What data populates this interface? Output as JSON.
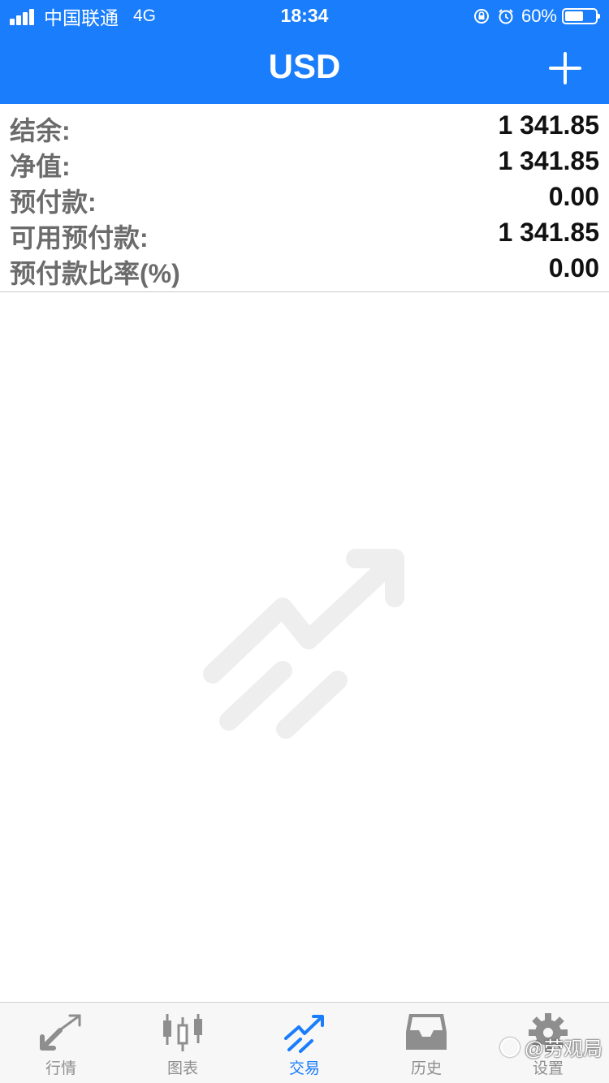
{
  "status_bar": {
    "carrier": "中国联通",
    "network": "4G",
    "time": "18:34",
    "battery_percent": "60%",
    "battery_level": 0.6,
    "icons": [
      "signal-icon",
      "orientation-lock-icon",
      "alarm-icon",
      "battery-icon"
    ]
  },
  "header": {
    "title": "USD",
    "add_icon": "plus-icon"
  },
  "account": {
    "rows": [
      {
        "label": "结余:",
        "value": "1 341.85"
      },
      {
        "label": "净值:",
        "value": "1 341.85"
      },
      {
        "label": "预付款:",
        "value": "0.00"
      },
      {
        "label": "可用预付款:",
        "value": "1 341.85"
      },
      {
        "label": "预付款比率(%)",
        "value": "0.00"
      }
    ]
  },
  "empty_state": {
    "icon": "trade-arrow-icon"
  },
  "tabs": [
    {
      "label": "行情",
      "icon": "quotes-icon",
      "active": false
    },
    {
      "label": "图表",
      "icon": "candlestick-chart-icon",
      "active": false
    },
    {
      "label": "交易",
      "icon": "trade-icon",
      "active": true
    },
    {
      "label": "历史",
      "icon": "history-inbox-icon",
      "active": false
    },
    {
      "label": "设置",
      "icon": "gear-icon",
      "active": false
    }
  ],
  "watermark": {
    "text": "@劳观局"
  },
  "colors": {
    "accent": "#1a7dfb",
    "tab_inactive": "#8e8e8e",
    "label_gray": "#6b6b6b",
    "empty_icon": "#eeeeee"
  }
}
